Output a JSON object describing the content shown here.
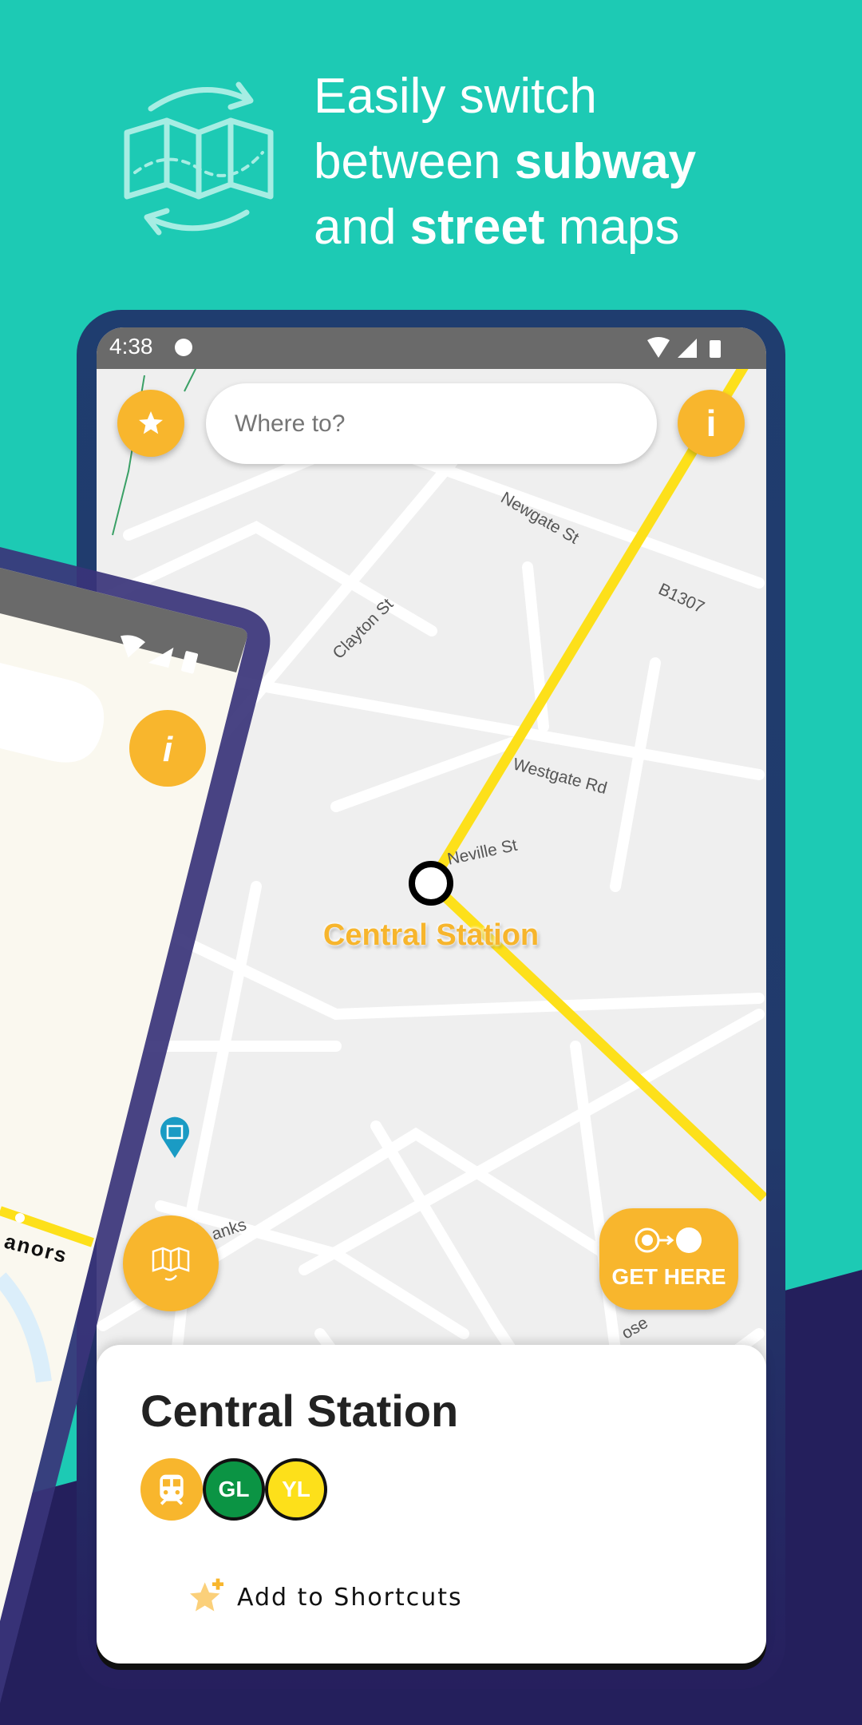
{
  "promo": {
    "line1": "Easily switch",
    "line2_pre": "between ",
    "line2_bold": "subway",
    "line3_pre": "and ",
    "line3_bold": "street",
    "line3_post": " maps",
    "icon": "map-switch-icon"
  },
  "status_bar": {
    "time": "4:38",
    "icons": [
      "notification-icon",
      "wifi-icon",
      "signal-icon",
      "battery-icon"
    ]
  },
  "search": {
    "placeholder": "Where to?"
  },
  "buttons": {
    "shortcuts_icon": "star-sparkle-icon",
    "info_label": "i",
    "map_toggle_icon": "map-switch-icon",
    "get_here_label": "GET HERE"
  },
  "map": {
    "streets": [
      "Newgate St",
      "B1307",
      "Clayton St",
      "Westgate Rd",
      "Neville St",
      "anks",
      "ose"
    ],
    "station_label": "Central Station",
    "line_color": "#fde01a"
  },
  "station_card": {
    "title": "Central Station",
    "badges": [
      {
        "label": "",
        "icon": "train-icon",
        "color": "#f8b62d"
      },
      {
        "label": "GL",
        "color": "#0b9444"
      },
      {
        "label": "YL",
        "color": "#fde01a"
      }
    ],
    "add_shortcut_label": "Add to Shortcuts"
  },
  "subway_phone": {
    "info_label": "i",
    "station_fragment": "anors"
  },
  "colors": {
    "teal": "#1dcab4",
    "accent": "#f8b62d",
    "navy": "#213a6b",
    "purple": "#241f5c"
  }
}
